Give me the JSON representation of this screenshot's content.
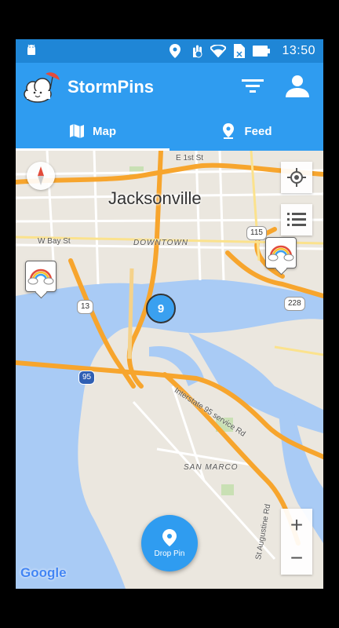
{
  "status_bar": {
    "time": "13:50"
  },
  "app": {
    "title": "StormPins",
    "logo": "rain-cloud-umbrella-logo"
  },
  "header_icons": {
    "filter": "filter-icon",
    "profile": "person-icon"
  },
  "tabs": [
    {
      "label": "Map",
      "icon": "map-icon",
      "active": true
    },
    {
      "label": "Feed",
      "icon": "location-pin-icon",
      "active": false
    }
  ],
  "map": {
    "city_label": "Jacksonville",
    "area_labels": [
      "DOWNTOWN",
      "SAN MARCO"
    ],
    "street_labels": [
      "E 1st St",
      "W Bay St",
      "Interstate 95 service Rd",
      "St Augustine Rd"
    ],
    "route_shields": [
      "115",
      "13",
      "228",
      "95"
    ],
    "cluster_count": "9",
    "attribution": "Google"
  },
  "pins": [
    {
      "icon": "rainbow-cloud-icon"
    },
    {
      "icon": "rainbow-cloud-icon"
    }
  ],
  "drop_pin_button": {
    "label": "Drop Pin"
  },
  "zoom": {
    "in": "+",
    "out": "−"
  },
  "colors": {
    "primary": "#2f9cf0",
    "status_bar": "#1f86d6",
    "water": "#a9cbf5",
    "highway": "#f7a52d"
  }
}
